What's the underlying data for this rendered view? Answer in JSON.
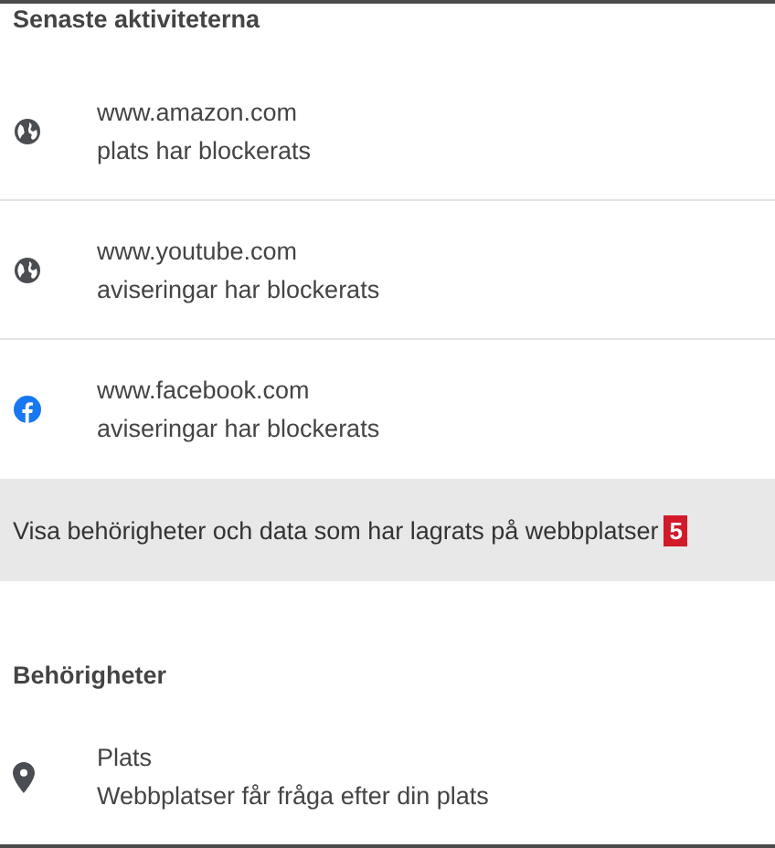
{
  "recent": {
    "heading": "Senaste aktiviteterna",
    "items": [
      {
        "kind": "globe",
        "site": "www.amazon.com",
        "status": "plats har blockerats"
      },
      {
        "kind": "globe",
        "site": "www.youtube.com",
        "status": "aviseringar har blockerats"
      },
      {
        "kind": "facebook",
        "site": "www.facebook.com",
        "status": "aviseringar har blockerats"
      }
    ]
  },
  "view_all": {
    "label": "Visa behörigheter och data som har lagrats på webbplatser",
    "badge": "5"
  },
  "permissions": {
    "heading": "Behörigheter",
    "items": [
      {
        "kind": "location",
        "title": "Plats",
        "description": "Webbplatser får fråga efter din plats"
      }
    ]
  }
}
